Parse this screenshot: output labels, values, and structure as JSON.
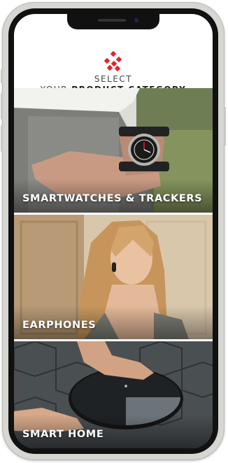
{
  "header": {
    "select": "SELECT",
    "your": "YOUR",
    "product_category": "PRODUCT CATEGORY"
  },
  "categories": [
    {
      "label": "SMARTWATCHES & TRACKERS"
    },
    {
      "label": "EARPHONES"
    },
    {
      "label": "SMART HOME"
    }
  ],
  "colors": {
    "accent": "#e2232a",
    "tile_text": "#ffffff"
  },
  "icons": [
    "brand-logo-icon"
  ]
}
